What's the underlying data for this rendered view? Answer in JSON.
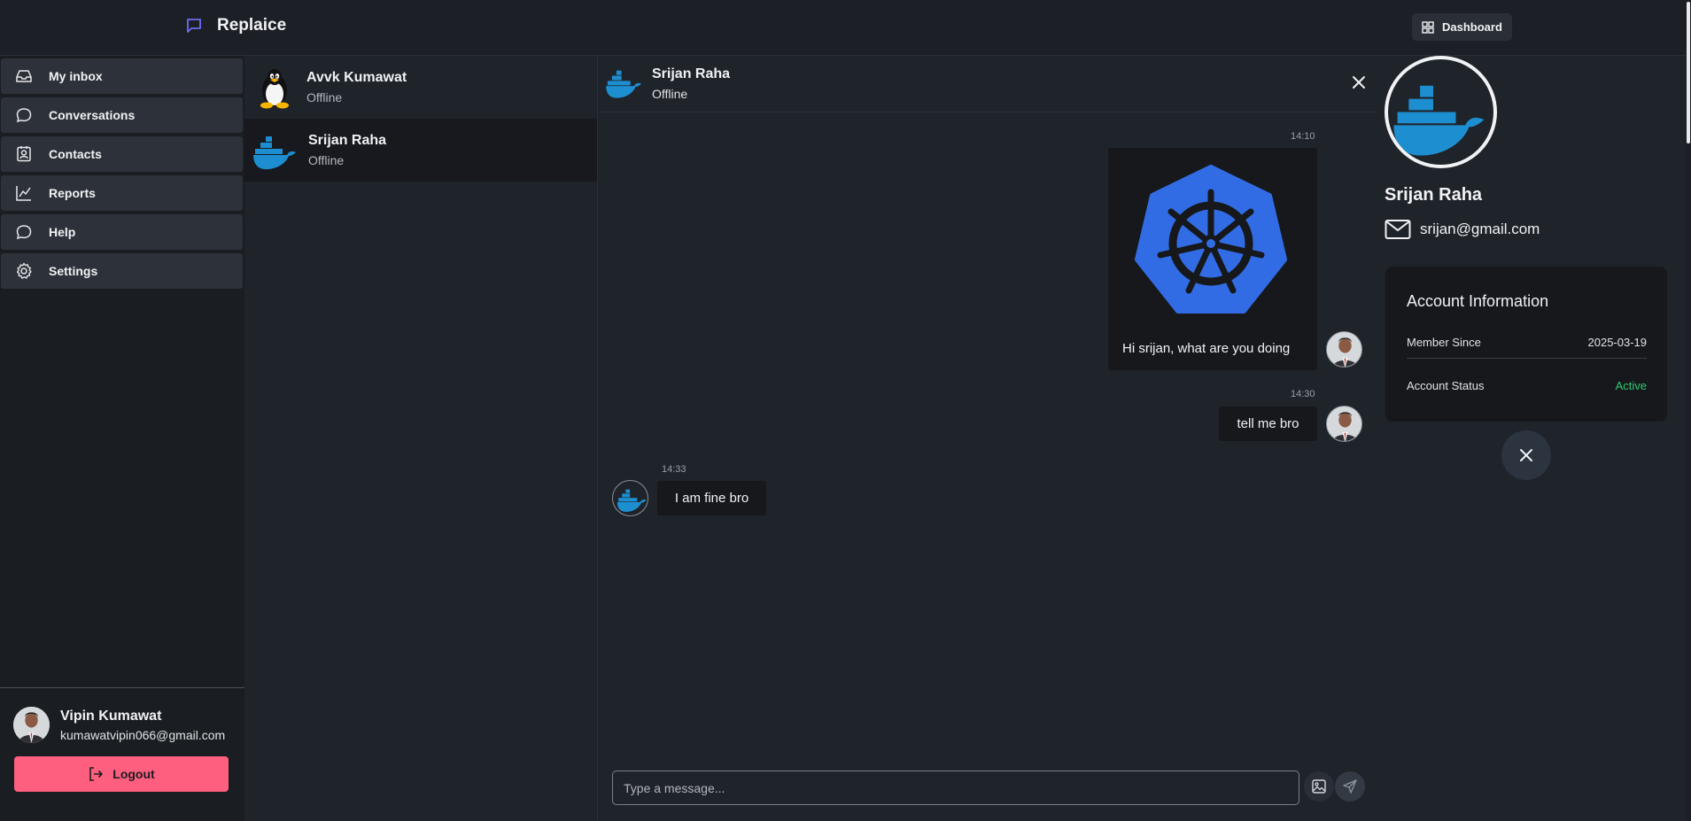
{
  "app": {
    "brand": "Replaice",
    "dashboard_label": "Dashboard"
  },
  "sidebar": {
    "items": [
      {
        "label": "My inbox",
        "icon": "inbox-icon"
      },
      {
        "label": "Conversations",
        "icon": "chat-bubble-icon"
      },
      {
        "label": "Contacts",
        "icon": "contact-card-icon"
      },
      {
        "label": "Reports",
        "icon": "line-chart-icon"
      },
      {
        "label": "Help",
        "icon": "help-bubble-icon"
      },
      {
        "label": "Settings",
        "icon": "gear-icon"
      }
    ],
    "user": {
      "name": "Vipin Kumawat",
      "email": "kumawatvipin066@gmail.com"
    },
    "logout_label": "Logout"
  },
  "contacts": [
    {
      "name": "Avvk Kumawat",
      "status": "Offline",
      "avatar": "linux-penguin"
    },
    {
      "name": "Srijan Raha",
      "status": "Offline",
      "avatar": "docker-whale"
    }
  ],
  "chat": {
    "header": {
      "name": "Srijan Raha",
      "status": "Offline"
    },
    "messages": [
      {
        "time": "14:10",
        "text": "Hi srijan, what are you doing",
        "attachment": "kubernetes-logo",
        "outgoing": true
      },
      {
        "time": "14:30",
        "text": "tell me bro",
        "outgoing": true
      },
      {
        "time": "14:33",
        "text": "I am fine bro",
        "outgoing": false
      }
    ],
    "composer_placeholder": "Type a message..."
  },
  "profile": {
    "name": "Srijan Raha",
    "email": "srijan@gmail.com",
    "account_title": "Account Information",
    "member_since_label": "Member Since",
    "member_since_value": "2025-03-19",
    "status_label": "Account Status",
    "status_value": "Active"
  },
  "colors": {
    "accent_brand": "#6c6cf0",
    "logout": "#ff5f7e",
    "docker_blue": "#1d8ecf",
    "kubernetes_blue": "#326ce5",
    "active_green": "#2ecc71"
  }
}
